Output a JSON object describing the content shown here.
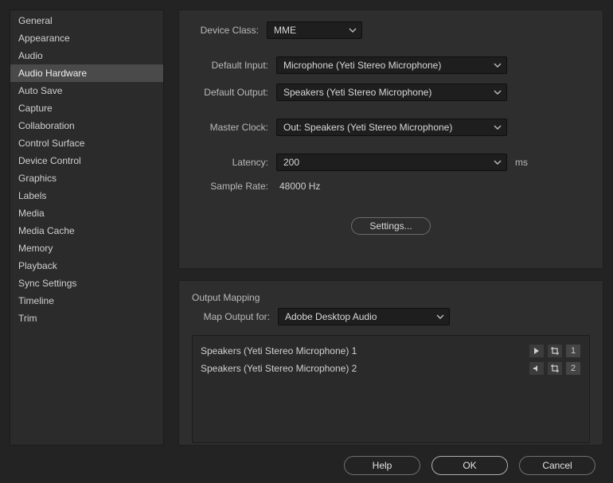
{
  "sidebar": {
    "items": [
      "General",
      "Appearance",
      "Audio",
      "Audio Hardware",
      "Auto Save",
      "Capture",
      "Collaboration",
      "Control Surface",
      "Device Control",
      "Graphics",
      "Labels",
      "Media",
      "Media Cache",
      "Memory",
      "Playback",
      "Sync Settings",
      "Timeline",
      "Trim"
    ],
    "selected_index": 3
  },
  "top": {
    "device_class_label": "Device Class:",
    "device_class_value": "MME",
    "default_input_label": "Default Input:",
    "default_input_value": "Microphone (Yeti Stereo Microphone)",
    "default_output_label": "Default Output:",
    "default_output_value": "Speakers (Yeti Stereo Microphone)",
    "master_clock_label": "Master Clock:",
    "master_clock_value": "Out: Speakers (Yeti Stereo Microphone)",
    "latency_label": "Latency:",
    "latency_value": "200",
    "latency_unit": "ms",
    "sample_rate_label": "Sample Rate:",
    "sample_rate_value": "48000 Hz",
    "settings_button": "Settings..."
  },
  "bottom": {
    "section_title": "Output Mapping",
    "map_output_label": "Map Output for:",
    "map_output_value": "Adobe Desktop Audio",
    "entries": [
      {
        "name": "Speakers (Yeti Stereo Microphone) 1",
        "num": "1"
      },
      {
        "name": "Speakers (Yeti Stereo Microphone) 2",
        "num": "2"
      }
    ]
  },
  "footer": {
    "help": "Help",
    "ok": "OK",
    "cancel": "Cancel"
  }
}
